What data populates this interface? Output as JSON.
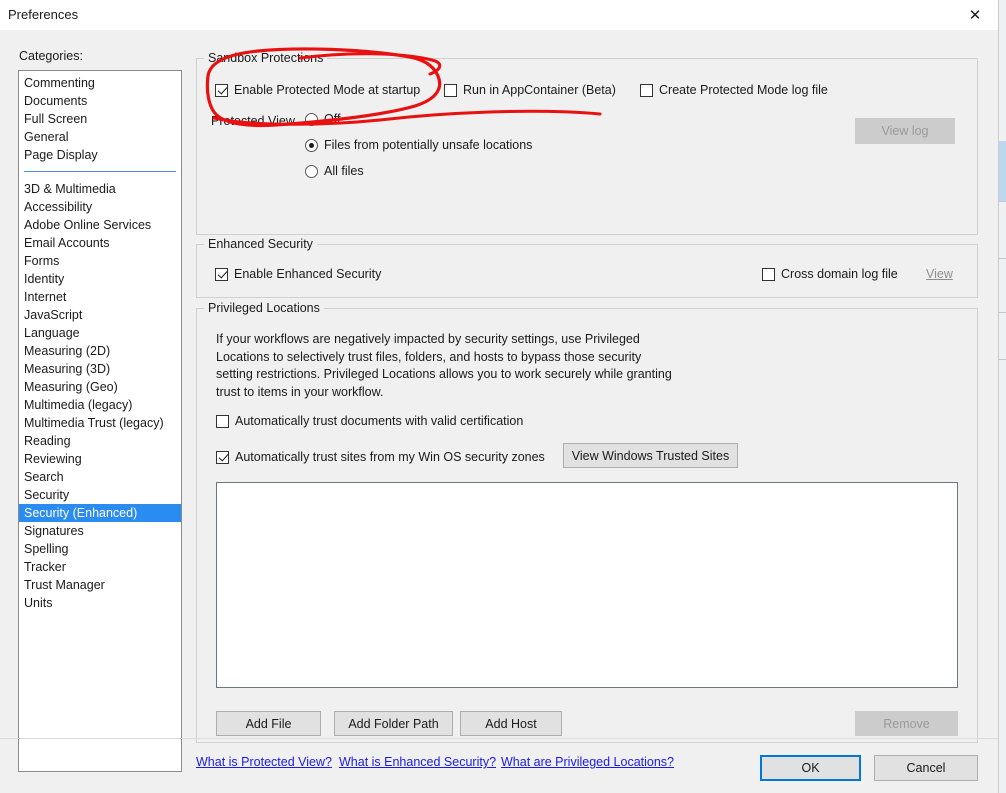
{
  "window": {
    "title": "Preferences",
    "close_icon": "close-icon"
  },
  "sidebar": {
    "label": "Categories:",
    "group1": [
      {
        "label": "Commenting"
      },
      {
        "label": "Documents"
      },
      {
        "label": "Full Screen"
      },
      {
        "label": "General"
      },
      {
        "label": "Page Display"
      }
    ],
    "group2": [
      {
        "label": "3D & Multimedia"
      },
      {
        "label": "Accessibility"
      },
      {
        "label": "Adobe Online Services"
      },
      {
        "label": "Email Accounts"
      },
      {
        "label": "Forms"
      },
      {
        "label": "Identity"
      },
      {
        "label": "Internet"
      },
      {
        "label": "JavaScript"
      },
      {
        "label": "Language"
      },
      {
        "label": "Measuring (2D)"
      },
      {
        "label": "Measuring (3D)"
      },
      {
        "label": "Measuring (Geo)"
      },
      {
        "label": "Multimedia (legacy)"
      },
      {
        "label": "Multimedia Trust (legacy)"
      },
      {
        "label": "Reading"
      },
      {
        "label": "Reviewing"
      },
      {
        "label": "Search"
      },
      {
        "label": "Security"
      },
      {
        "label": "Security (Enhanced)"
      },
      {
        "label": "Signatures"
      },
      {
        "label": "Spelling"
      },
      {
        "label": "Tracker"
      },
      {
        "label": "Trust Manager"
      },
      {
        "label": "Units"
      }
    ],
    "selected": "Security (Enhanced)"
  },
  "sandbox": {
    "title": "Sandbox Protections",
    "enable_protected_mode": {
      "label": "Enable Protected Mode at startup",
      "checked": true
    },
    "run_in_appcontainer": {
      "label": "Run in AppContainer (Beta)",
      "checked": false
    },
    "create_log_file": {
      "label": "Create Protected Mode log file",
      "checked": false
    },
    "view_log_button": {
      "label": "View log",
      "disabled": true
    },
    "protected_view_label": "Protected View",
    "protected_view_options": [
      {
        "label": "Off",
        "selected": false
      },
      {
        "label": "Files from potentially unsafe locations",
        "selected": true
      },
      {
        "label": "All files",
        "selected": false
      }
    ]
  },
  "enhanced_security": {
    "title": "Enhanced Security",
    "enable": {
      "label": "Enable Enhanced Security",
      "checked": true
    },
    "cross_domain_log": {
      "label": "Cross domain log file",
      "checked": false
    },
    "view_link": {
      "label": "View",
      "disabled": true
    }
  },
  "privileged_locations": {
    "title": "Privileged Locations",
    "description": "If your workflows are negatively impacted by security settings, use Privileged Locations to selectively trust files, folders, and hosts to bypass those security setting restrictions. Privileged Locations allows you to work securely while granting trust to items in your workflow.",
    "trust_valid_certification": {
      "label": "Automatically trust documents with valid certification",
      "checked": false
    },
    "trust_win_os_zones": {
      "label": "Automatically trust sites from my Win OS security zones",
      "checked": true
    },
    "view_trusted_sites_button": {
      "label": "View Windows Trusted Sites"
    },
    "list_items": [],
    "add_file_button": {
      "label": "Add File"
    },
    "add_folder_button": {
      "label": "Add Folder Path"
    },
    "add_host_button": {
      "label": "Add Host"
    },
    "remove_button": {
      "label": "Remove",
      "disabled": true
    }
  },
  "help_links": [
    {
      "label": "What is Protected View?"
    },
    {
      "label": "What is Enhanced Security?"
    },
    {
      "label": "What are Privileged Locations?"
    }
  ],
  "dialog_buttons": {
    "ok": {
      "label": "OK",
      "is_default": true
    },
    "cancel": {
      "label": "Cancel"
    }
  },
  "colors": {
    "selection_blue": "#2a8cf0",
    "focus_blue": "#0078d7",
    "link_blue": "#1a1ae6",
    "annotation_red": "#e81010",
    "dialog_background": "#f0f0f0"
  },
  "annotation": {
    "type": "hand-drawn-ellipse",
    "color": "#e81010",
    "target": "Enable Protected Mode at startup"
  }
}
